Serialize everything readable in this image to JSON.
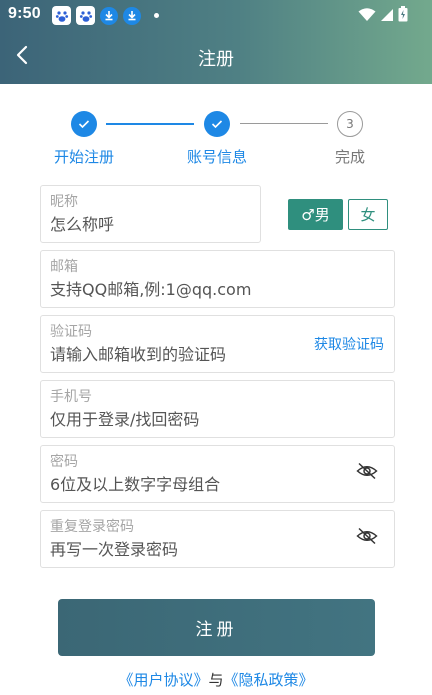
{
  "status_bar": {
    "time": "9:50"
  },
  "header": {
    "title": "注册"
  },
  "steps": [
    {
      "label": "开始注册",
      "state": "done",
      "number": "1"
    },
    {
      "label": "账号信息",
      "state": "done",
      "number": "2"
    },
    {
      "label": "完成",
      "state": "todo",
      "number": "3"
    }
  ],
  "form": {
    "nickname": {
      "label": "昵称",
      "placeholder": "怎么称呼"
    },
    "gender": {
      "male_label": "♂男",
      "female_label": "女",
      "selected": "male"
    },
    "email": {
      "label": "邮箱",
      "placeholder": "支持QQ邮箱,例:1@qq.com"
    },
    "code": {
      "label": "验证码",
      "placeholder": "请输入邮箱收到的验证码",
      "button_label": "获取验证码"
    },
    "phone": {
      "label": "手机号",
      "placeholder": "仅用于登录/找回密码"
    },
    "password": {
      "label": "密码",
      "placeholder": "6位及以上数字字母组合"
    },
    "confirm_password": {
      "label": "重复登录密码",
      "placeholder": "再写一次登录密码"
    }
  },
  "submit_label": "注册",
  "agreement": {
    "user_link": "《用户协议》",
    "joiner": "与",
    "privacy_link": "《隐私政策》"
  },
  "colors": {
    "accent": "#1e88e5",
    "primary": "#2f8f7e",
    "button": "#3b6775"
  }
}
